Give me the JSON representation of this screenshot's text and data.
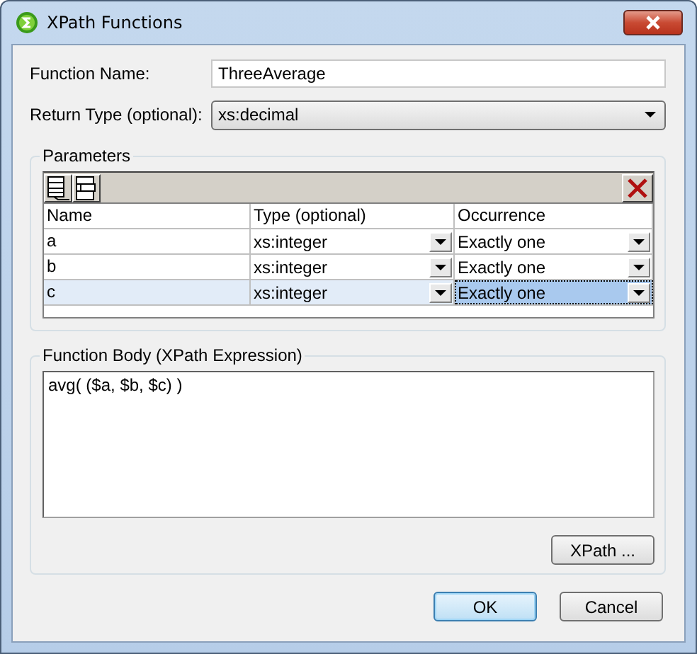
{
  "window": {
    "title": "XPath Functions"
  },
  "function_name": {
    "label": "Function Name:",
    "value": "ThreeAverage"
  },
  "return_type": {
    "label": "Return Type (optional):",
    "value": "xs:decimal"
  },
  "parameters": {
    "title": "Parameters",
    "columns": [
      "Name",
      "Type (optional)",
      "Occurrence"
    ],
    "rows": [
      {
        "name": "a",
        "type": "xs:integer",
        "occurrence": "Exactly one",
        "selected": false
      },
      {
        "name": "b",
        "type": "xs:integer",
        "occurrence": "Exactly one",
        "selected": false
      },
      {
        "name": "c",
        "type": "xs:integer",
        "occurrence": "Exactly one",
        "selected": true
      }
    ]
  },
  "function_body": {
    "title": "Function Body (XPath Expression)",
    "value": "avg( ($a, $b, $c) )",
    "button": "XPath ..."
  },
  "buttons": [
    {
      "label": "OK",
      "default": true
    },
    {
      "label": "Cancel",
      "default": false
    }
  ]
}
